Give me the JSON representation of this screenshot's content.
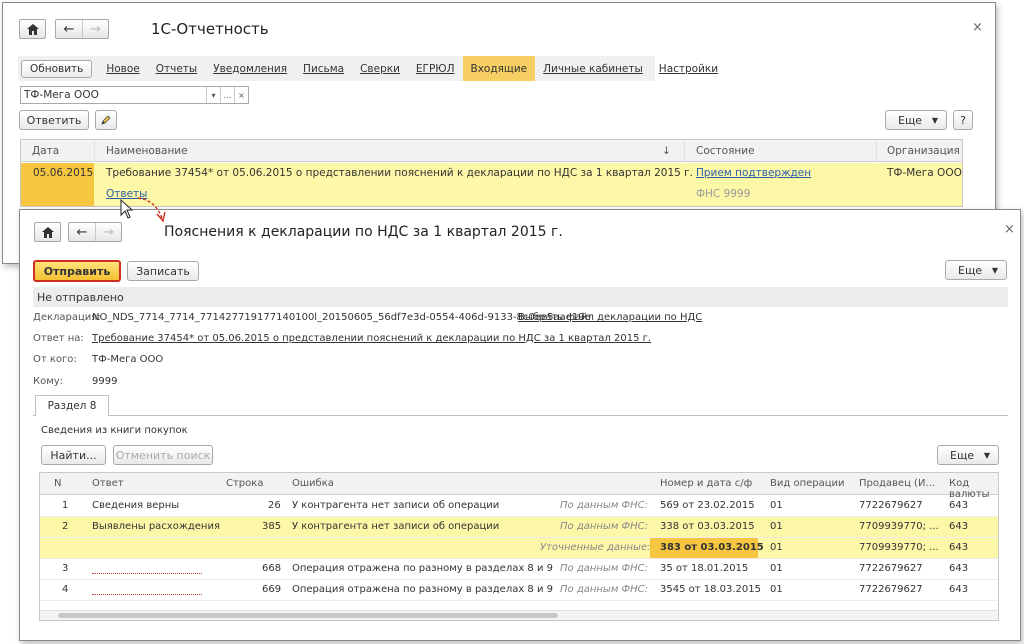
{
  "window1": {
    "title": "1С-Отчетность",
    "close": "×",
    "toolbar": {
      "refresh": "Обновить",
      "new": "Новое"
    },
    "tabs": [
      "Отчеты",
      "Уведомления",
      "Письма",
      "Сверки",
      "ЕГРЮЛ",
      "Входящие",
      "Личные кабинеты",
      "Настройки"
    ],
    "active_tab": "Входящие",
    "org_select": {
      "value": "ТФ-Мега ООО",
      "btn_dropdown": "▾",
      "btn_more": "...",
      "btn_clear": "×"
    },
    "reply_button": "Ответить",
    "more_button": "Еще",
    "help_button": "?",
    "grid": {
      "columns": [
        "Дата",
        "Наименование",
        "Состояние",
        "Организация"
      ],
      "sort_indicator": "↓",
      "row": {
        "date": "05.06.2015",
        "name": "Требование 37454* от 05.06.2015 о представлении пояснений к декларации по НДС за 1 квартал 2015 г.",
        "sublink": "Ответы",
        "status": "Прием подтвержден",
        "status_sub": "ФНС 9999",
        "org": "ТФ-Мега ООО"
      }
    }
  },
  "window2": {
    "title": "Пояснения к декларации по НДС за 1 квартал 2015 г.",
    "close": "×",
    "send_button": "Отправить",
    "save_button": "Записать",
    "more_button": "Еще",
    "status": "Не отправлено",
    "fields": {
      "declaration_label": "Декларация:",
      "declaration_value": "NO_NDS_7714_7714_771427719177140100l_20150605_56df7e3d-0554-406d-9133-8c0ee5aae19e",
      "declaration_link": "Выбрать файл декларации по НДС",
      "reply_to_label": "Ответ на:",
      "reply_to_value": "Требование 37454* от 05.06.2015 о представлении пояснений к декларации по НДС за 1 квартал 2015 г.",
      "from_label": "От кого:",
      "from_value": "ТФ-Мега ООО",
      "to_label": "Кому:",
      "to_value": "9999"
    },
    "section_tab": "Раздел 8",
    "section_link": "Сведения из книги покупок",
    "find_button": "Найти...",
    "cancel_search_button": "Отменить поиск",
    "grid_more_button": "Еще",
    "grid": {
      "columns": [
        "N",
        "Ответ",
        "Строка",
        "Ошибка",
        "Номер и дата с/ф",
        "Вид операции",
        "Продавец (И...",
        "Код валюты"
      ],
      "rows": [
        {
          "n": "1",
          "answer": "Сведения верны",
          "line": "26",
          "error": "У контрагента нет записи об операции",
          "src": "По данным ФНС:",
          "invoice": "569 от 23.02.2015",
          "op": "01",
          "seller": "7722679627",
          "currency": "643"
        },
        {
          "n": "2",
          "answer": "Выявлены расхождения",
          "line": "385",
          "error": "У контрагента нет записи об операции",
          "src": "По данным ФНС:",
          "invoice": "338 от 03.03.2015",
          "op": "01",
          "seller": "7709939770; ...",
          "currency": "643"
        },
        {
          "n": "",
          "answer": "",
          "line": "",
          "error": "",
          "src": "Уточненные данные:",
          "invoice": "383 от 03.03.2015",
          "op": "01",
          "seller": "7709939770; ...",
          "currency": "643"
        },
        {
          "n": "3",
          "answer": "",
          "line": "668",
          "error": "Операция отражена по разному в разделах 8 и 9",
          "src": "По данным ФНС:",
          "invoice": "35 от 18.01.2015",
          "op": "01",
          "seller": "7722679627",
          "currency": "643"
        },
        {
          "n": "4",
          "answer": "",
          "line": "669",
          "error": "Операция отражена по разному в разделах 8 и 9",
          "src": "По данным ФНС:",
          "invoice": "3545 от 18.03.2015",
          "op": "01",
          "seller": "7722679627",
          "currency": "643"
        }
      ]
    }
  },
  "colors": {
    "accent_yellow": "#f6c640",
    "row_yellow": "#fdf7a8",
    "link": "#2b5ea8",
    "send_border": "#d12f1f"
  }
}
